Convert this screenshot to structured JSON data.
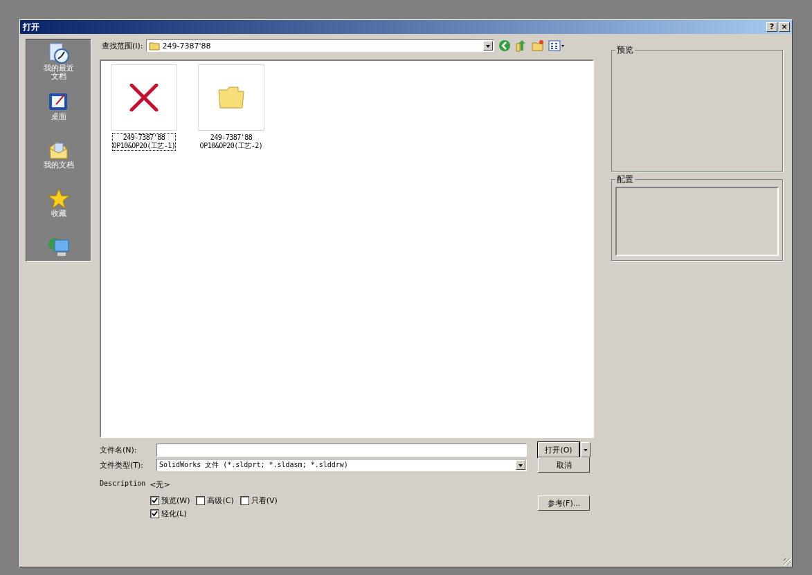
{
  "window": {
    "title": "打开",
    "help_button": "?",
    "close_button": "×"
  },
  "sidebar": {
    "items": [
      {
        "label": "我的最近文档",
        "kind": "recent"
      },
      {
        "label": "桌面",
        "kind": "desktop"
      },
      {
        "label": "我的文档",
        "kind": "documents"
      },
      {
        "label": "收藏",
        "kind": "favorites"
      },
      {
        "kind": "network"
      }
    ]
  },
  "look_in": {
    "label": "查找范围(I):",
    "value": "249-7387'88"
  },
  "files": [
    {
      "line1": "249-7387'88",
      "line2": "OP10&OP20(工艺-1)",
      "kind": "missing",
      "selected": true
    },
    {
      "line1": "249-7387'88",
      "line2": "OP10&OP20(工艺-2)",
      "kind": "folder",
      "selected": false
    }
  ],
  "file_name": {
    "label": "文件名(N):"
  },
  "file_type": {
    "label": "文件类型(T):",
    "value": "SolidWorks 文件 (*.sldprt; *.sldasm; *.slddrw)"
  },
  "description": {
    "label": "Description",
    "value": "<无>"
  },
  "options": [
    {
      "label": "预览(W)",
      "checked": true
    },
    {
      "label": "高级(C)",
      "checked": false
    },
    {
      "label": "只看(V)",
      "checked": false
    },
    {
      "label": "轻化(L)",
      "checked": true
    }
  ],
  "buttons": {
    "open": "打开(O)",
    "cancel": "取消",
    "references": "参考(F)..."
  },
  "preview": {
    "title": "预览"
  },
  "config": {
    "title": "配置"
  }
}
